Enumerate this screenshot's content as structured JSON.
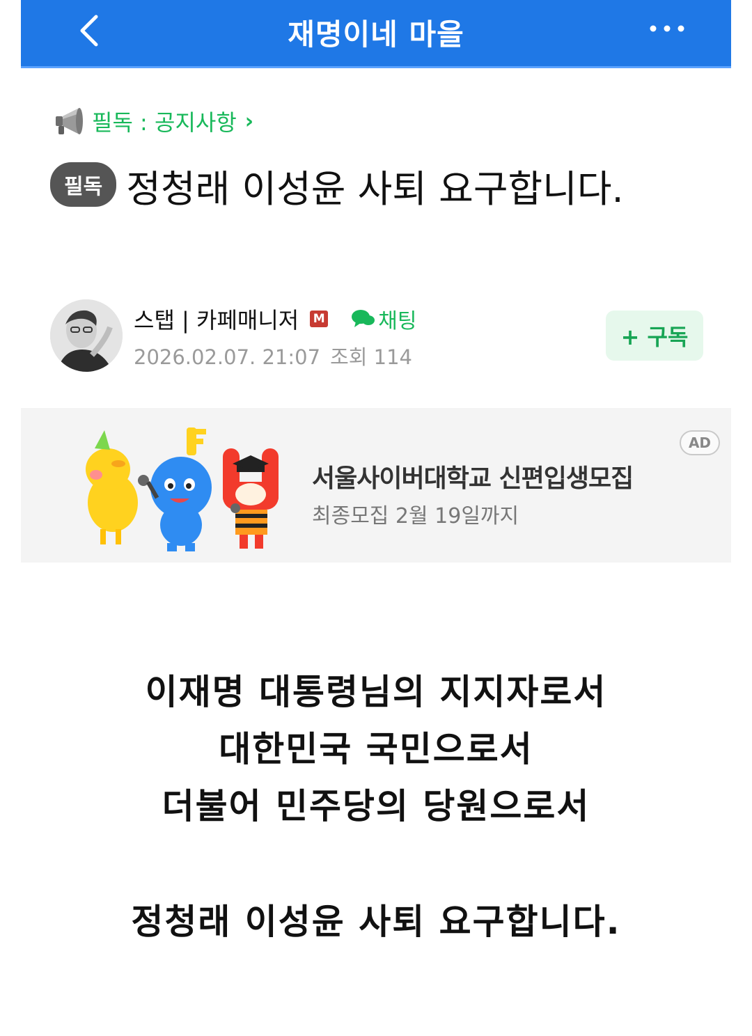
{
  "header": {
    "title": "재명이네 마을",
    "back_icon": "chevron-left-icon",
    "more_icon": "more-horizontal-icon"
  },
  "notice": {
    "icon": "megaphone-icon",
    "label": "필독 : 공지사항",
    "chevron": "›"
  },
  "post": {
    "badge": "필독",
    "title": "정청래 이성윤 사퇴 요구합니다."
  },
  "author": {
    "name": "스탭 | 카페매니저",
    "manager_badge": "M",
    "chat_label": "채팅",
    "date": "2026.02.07. 21:07",
    "views_label": "조회 114"
  },
  "subscribe": {
    "label": "+ 구독"
  },
  "ad": {
    "title": "서울사이버대학교 신편입생모집",
    "subtitle": "최종모집 2월 19일까지",
    "badge": "AD"
  },
  "body": {
    "lines": [
      "이재명 대통령님의 지지자로서",
      "대한민국 국민으로서",
      "더불어 민주당의 당원으로서",
      "정청래 이성윤 사퇴 요구합니다."
    ]
  },
  "colors": {
    "header_bg": "#1f78e6",
    "accent_green": "#18b85a",
    "badge_gray": "#555555",
    "manager_red": "#c73a32"
  }
}
